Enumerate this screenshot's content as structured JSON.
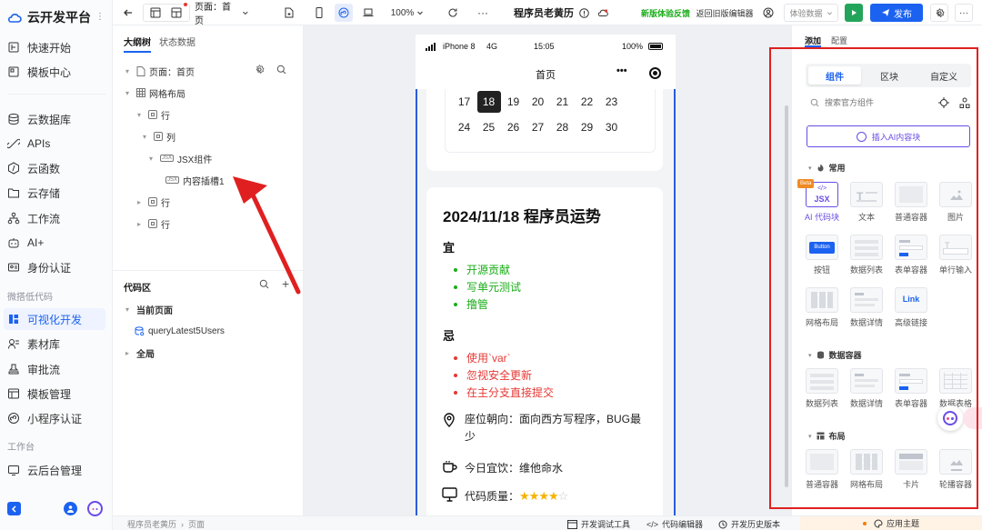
{
  "brand": {
    "name": "云开发平台"
  },
  "nav": {
    "items_top": [
      "快速开始",
      "模板中心"
    ],
    "items_mid": [
      "云数据库",
      "APIs",
      "云函数",
      "云存储",
      "工作流",
      "AI+",
      "身份认证"
    ],
    "section_lowcode": "微搭低代码",
    "items_low": [
      "可视化开发",
      "素材库",
      "审批流",
      "模板管理",
      "小程序认证"
    ],
    "section_workspace": "工作台",
    "items_work": [
      "云后台管理"
    ]
  },
  "topbar": {
    "page_select": "页面：首页",
    "zoom": "100%",
    "app_title": "程序员老黄历",
    "feedback": "新版体验反馈",
    "back_old": "返回旧版编辑器",
    "env_select": "体验数据",
    "publish": "发布"
  },
  "outline": {
    "tabs": [
      "大纲树",
      "状态数据"
    ],
    "tree": [
      "页面：首页",
      "网格布局",
      "行",
      "列",
      "JSX组件",
      "内容插槽1",
      "行",
      "行"
    ]
  },
  "code": {
    "title": "代码区",
    "current_page": "当前页面",
    "query": "queryLatest5Users",
    "global": "全局"
  },
  "phone": {
    "carrier": "iPhone 8",
    "network": "4G",
    "time": "15:05",
    "battery": "100%",
    "nav_title": "首页",
    "more": "•••",
    "cal_row1": [
      "17",
      "18",
      "19",
      "20",
      "21",
      "22",
      "23"
    ],
    "cal_row2": [
      "24",
      "25",
      "26",
      "27",
      "28",
      "29",
      "30"
    ],
    "fortune_title": "2024/11/18 程序员运势",
    "yi_label": "宜",
    "yi_items": [
      "开源贡献",
      "写单元测试",
      "撸管"
    ],
    "ji_label": "忌",
    "ji_items": [
      "使用`var`",
      "忽视安全更新",
      "在主分支直接提交"
    ],
    "seat": "座位朝向：面向西方写程序，BUG最少",
    "drink": "今日宜饮：维他命水",
    "quality_label": "代码质量：",
    "quality_stars": 4,
    "quality_max": 5
  },
  "right": {
    "tabs": [
      "添加",
      "配置"
    ],
    "seg": [
      "组件",
      "区块",
      "自定义"
    ],
    "search_placeholder": "搜索官方组件",
    "insert_ai": "插入AI内容块",
    "sec_common": "常用",
    "common": [
      "AI 代码块",
      "文本",
      "普通容器",
      "图片",
      "按钮",
      "数据列表",
      "表单容器",
      "单行输入",
      "网格布局",
      "数据详情",
      "高级链接"
    ],
    "beta": "Beta",
    "jsx_text": "JSX",
    "button_text": "Button",
    "link_text": "Link",
    "sec_data": "数据容器",
    "data": [
      "数据列表",
      "数据详情",
      "表单容器",
      "数据表格"
    ],
    "sec_layout": "布局",
    "layout": [
      "普通容器",
      "网格布局",
      "卡片",
      "轮播容器"
    ]
  },
  "bottom": {
    "crumbs": [
      "程序员老黄历",
      "页面"
    ],
    "debug": "开发调试工具",
    "editor": "代码编辑器",
    "history": "开发历史版本",
    "theme": "应用主题"
  },
  "colors": {
    "accent": "#1c62f0",
    "green": "#1aad19",
    "red": "#e53935",
    "annotation": "#e02020"
  }
}
